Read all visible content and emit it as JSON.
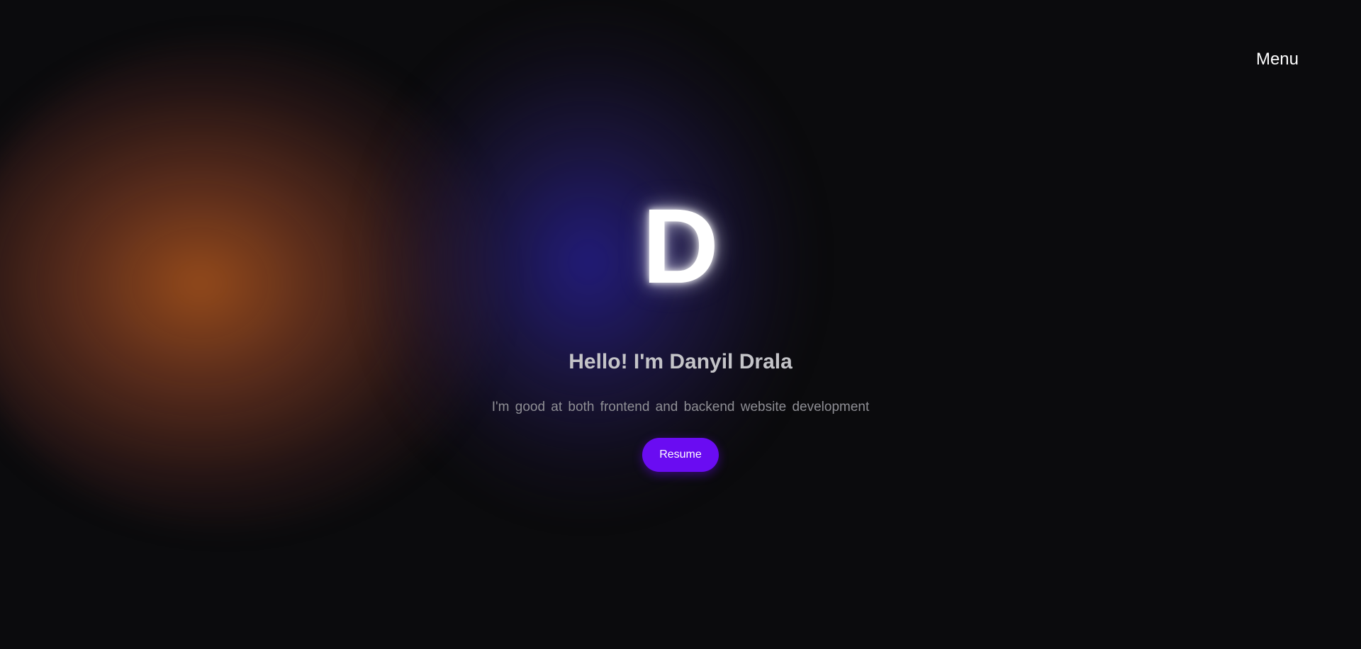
{
  "header": {
    "menu_label": "Menu"
  },
  "hero": {
    "logo_letter": "D",
    "greeting": "Hello! I'm Danyil Drala",
    "tagline": "I'm good at both frontend and backend website development",
    "resume_label": "Resume"
  },
  "colors": {
    "background": "#0b0b0d",
    "accent": "#6a0cf2",
    "glow_orange": "#c46020",
    "glow_blue": "#28209a"
  }
}
